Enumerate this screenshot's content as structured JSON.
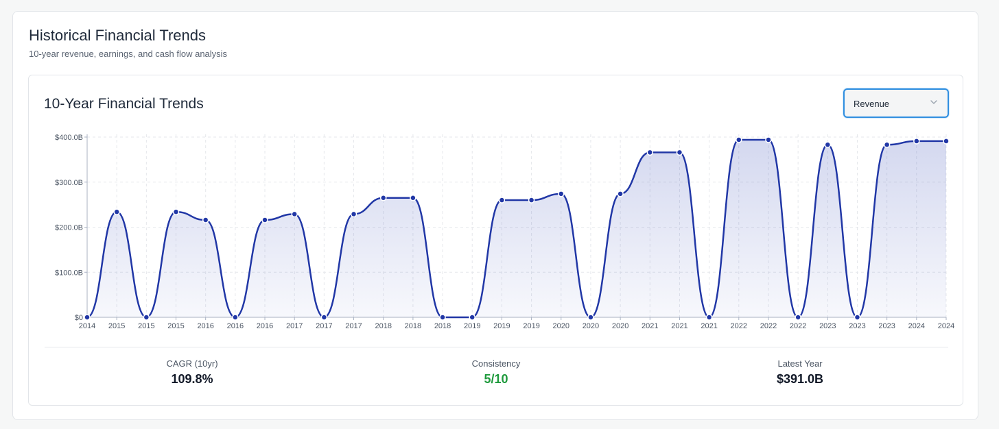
{
  "section": {
    "title": "Historical Financial Trends",
    "subtitle": "10-year revenue, earnings, and cash flow analysis"
  },
  "card": {
    "title": "10-Year Financial Trends",
    "metric_select": {
      "value": "Revenue",
      "icon": "chevron-down-icon"
    }
  },
  "chart_data": {
    "type": "area",
    "series": [
      {
        "values": [
          0,
          234,
          0,
          234,
          216,
          0,
          216,
          229,
          0,
          229,
          265,
          265,
          0,
          0,
          260,
          260,
          274,
          0,
          274,
          366,
          366,
          0,
          394,
          394,
          0,
          383,
          0,
          383,
          391,
          391
        ]
      }
    ],
    "categories": [
      "2014",
      "2015",
      "2015",
      "2015",
      "2016",
      "2016",
      "2016",
      "2017",
      "2017",
      "2017",
      "2018",
      "2018",
      "2018",
      "2019",
      "2019",
      "2019",
      "2020",
      "2020",
      "2020",
      "2021",
      "2021",
      "2021",
      "2022",
      "2022",
      "2022",
      "2023",
      "2023",
      "2023",
      "2024",
      "2024"
    ],
    "y_ticks": [
      "$0",
      "$100.0B",
      "$200.0B",
      "$300.0B",
      "$400.0B"
    ],
    "ylim": [
      0,
      400
    ],
    "unit": "$B",
    "grid": true,
    "legend": "none",
    "colors": {
      "line": "#2137a6",
      "fill": "#3b4fb8",
      "grid": "#e5e7eb",
      "axis": "#a8b1c2"
    }
  },
  "stats": {
    "cagr": {
      "label": "CAGR (10yr)",
      "value": "109.8%"
    },
    "consistency": {
      "label": "Consistency",
      "value": "5/10",
      "color": "#1e9a3c"
    },
    "latest": {
      "label": "Latest Year",
      "value": "$391.0B"
    }
  }
}
